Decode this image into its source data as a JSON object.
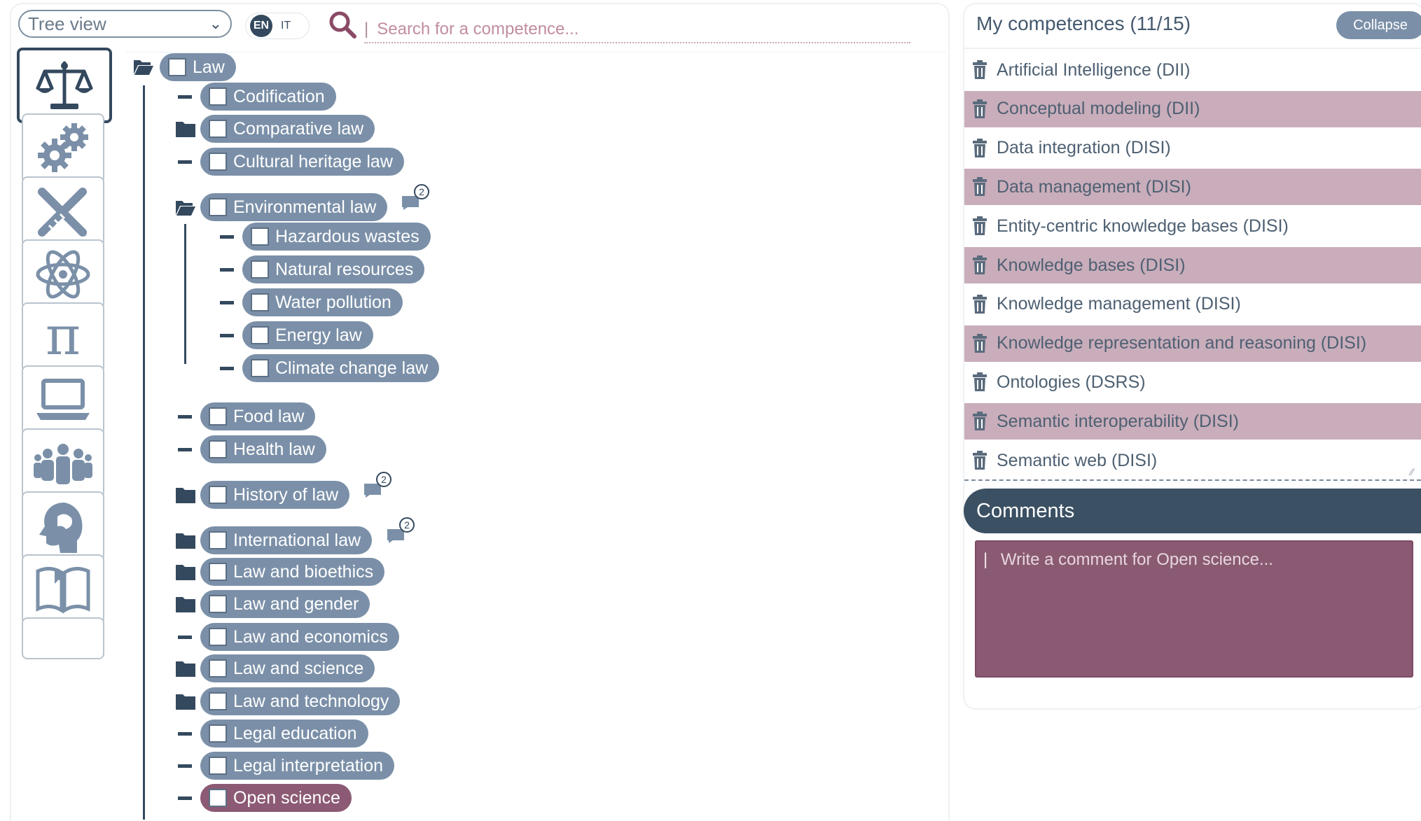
{
  "top_bar": {
    "view_select": "Tree view",
    "lang_selected": "EN",
    "lang_other": "IT",
    "search_placeholder": "Search for a competence..."
  },
  "categories": [
    {
      "icon": "scales-icon",
      "selected": true
    },
    {
      "icon": "gears-icon",
      "selected": false
    },
    {
      "icon": "tools-icon",
      "selected": false
    },
    {
      "icon": "atom-icon",
      "selected": false
    },
    {
      "icon": "pi-icon",
      "selected": false
    },
    {
      "icon": "laptop-icon",
      "selected": false
    },
    {
      "icon": "people-icon",
      "selected": false
    },
    {
      "icon": "head-icon",
      "selected": false
    },
    {
      "icon": "book-icon",
      "selected": false
    }
  ],
  "tree": {
    "root": "Law",
    "items": [
      {
        "label": "Codification",
        "marker": "leaf"
      },
      {
        "label": "Comparative law",
        "marker": "folder-closed"
      },
      {
        "label": "Cultural heritage law",
        "marker": "leaf"
      },
      {
        "label": "Environmental law",
        "marker": "folder-open",
        "badge": "2"
      },
      {
        "label": "Hazardous wastes",
        "marker": "leaf"
      },
      {
        "label": "Natural resources",
        "marker": "leaf"
      },
      {
        "label": "Water pollution",
        "marker": "leaf"
      },
      {
        "label": "Energy law",
        "marker": "leaf"
      },
      {
        "label": "Climate change law",
        "marker": "leaf"
      },
      {
        "label": "Food law",
        "marker": "leaf"
      },
      {
        "label": "Health law",
        "marker": "leaf"
      },
      {
        "label": "History of law",
        "marker": "folder-closed",
        "badge": "2"
      },
      {
        "label": "International law",
        "marker": "folder-closed",
        "badge": "2"
      },
      {
        "label": "Law and bioethics",
        "marker": "folder-closed"
      },
      {
        "label": "Law and gender",
        "marker": "folder-closed"
      },
      {
        "label": "Law and economics",
        "marker": "leaf"
      },
      {
        "label": "Law and science",
        "marker": "folder-closed"
      },
      {
        "label": "Law and technology",
        "marker": "folder-closed"
      },
      {
        "label": "Legal education",
        "marker": "leaf"
      },
      {
        "label": "Legal interpretation",
        "marker": "leaf"
      },
      {
        "label": "Open science",
        "marker": "leaf",
        "selected": true
      }
    ]
  },
  "my_competences": {
    "title": "My competences (11/15)",
    "collapse_label": "Collapse",
    "items": [
      "Artificial Intelligence (DII)",
      "Conceptual modeling (DII)",
      "Data integration (DISI)",
      "Data management (DISI)",
      "Entity-centric knowledge bases (DISI)",
      "Knowledge bases (DISI)",
      "Knowledge management (DISI)",
      "Knowledge representation and reasoning (DISI)",
      "Ontologies (DSRS)",
      "Semantic interoperability (DISI)",
      "Semantic web (DISI)"
    ]
  },
  "comments": {
    "header": "Comments",
    "placeholder": "Write a comment for Open science..."
  },
  "colors": {
    "pill": "#7b90a8",
    "pill_selected": "#8c5a74",
    "dark": "#34495e",
    "row_alt": "#c9adbb",
    "comment_bg": "#8a5a73"
  }
}
